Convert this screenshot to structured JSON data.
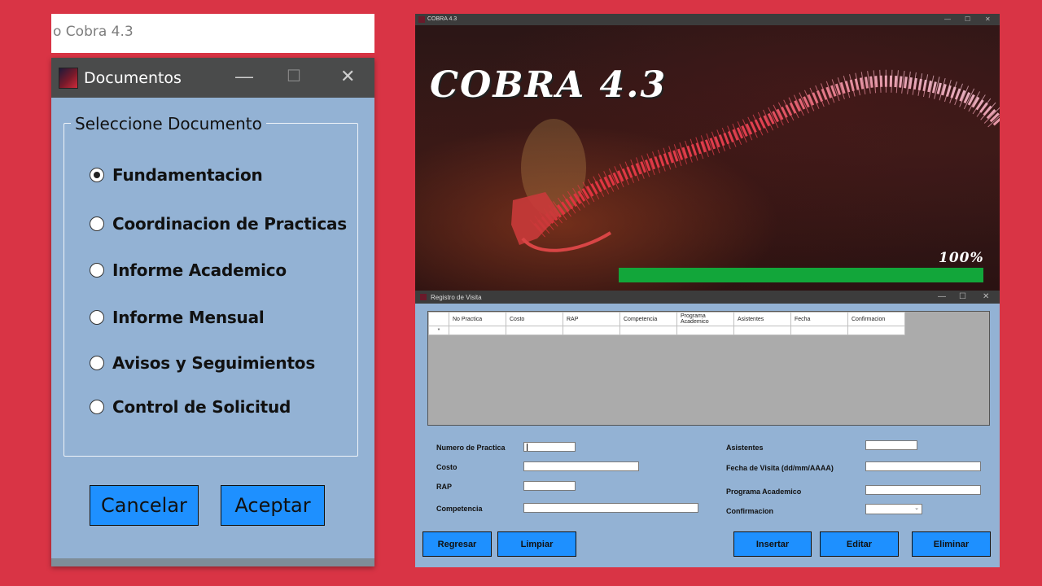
{
  "background_color": "#d93445",
  "partial_window": {
    "title": "o Cobra 4.3"
  },
  "documentos": {
    "title": "Documentos",
    "window_controls": {
      "minimize": "—",
      "maximize": "☐",
      "close": "✕"
    },
    "group_title": "Seleccione Documento",
    "options": [
      {
        "label": "Fundamentacion",
        "checked": true
      },
      {
        "label": "Coordinacion de Practicas",
        "checked": false
      },
      {
        "label": "Informe Academico",
        "checked": false
      },
      {
        "label": "Informe Mensual",
        "checked": false
      },
      {
        "label": "Avisos y Seguimientos",
        "checked": false
      },
      {
        "label": "Control de Solicitud",
        "checked": false
      }
    ],
    "buttons": {
      "cancel": "Cancelar",
      "accept": "Aceptar"
    },
    "button_color": "#1e90ff",
    "panel_color": "#93b2d4"
  },
  "splash": {
    "title": "COBRA 4.3",
    "logo_text": "COBRA 4.3",
    "progress_text": "100%",
    "progress_percent": 100,
    "progress_color": "#12a63a",
    "window_controls": {
      "minimize": "—",
      "maximize": "☐",
      "close": "✕"
    }
  },
  "registro": {
    "title": "Registro de Visita",
    "window_controls": {
      "minimize": "—",
      "maximize": "☐",
      "close": "✕"
    },
    "grid": {
      "columns": [
        "No Practica",
        "Costo",
        "RAP",
        "Competencia",
        "Programa Academico",
        "Asistentes",
        "Fecha",
        "Confirmacion"
      ],
      "new_row_marker": "*"
    },
    "fields": {
      "numero_practica": {
        "label": "Numero de Practica",
        "value": ""
      },
      "costo": {
        "label": "Costo",
        "value": ""
      },
      "rap": {
        "label": "RAP",
        "value": ""
      },
      "competencia": {
        "label": "Competencia",
        "value": ""
      },
      "asistentes": {
        "label": "Asistentes",
        "value": ""
      },
      "fecha_visita": {
        "label": "Fecha de Visita (dd/mm/AAAA)",
        "value": ""
      },
      "programa_academico": {
        "label": "Programa Academico",
        "value": ""
      },
      "confirmacion": {
        "label": "Confirmacion",
        "value": "",
        "chevron": "⌄"
      }
    },
    "buttons": {
      "regresar": "Regresar",
      "limpiar": "Limpiar",
      "insertar": "Insertar",
      "editar": "Editar",
      "eliminar": "Eliminar"
    }
  }
}
